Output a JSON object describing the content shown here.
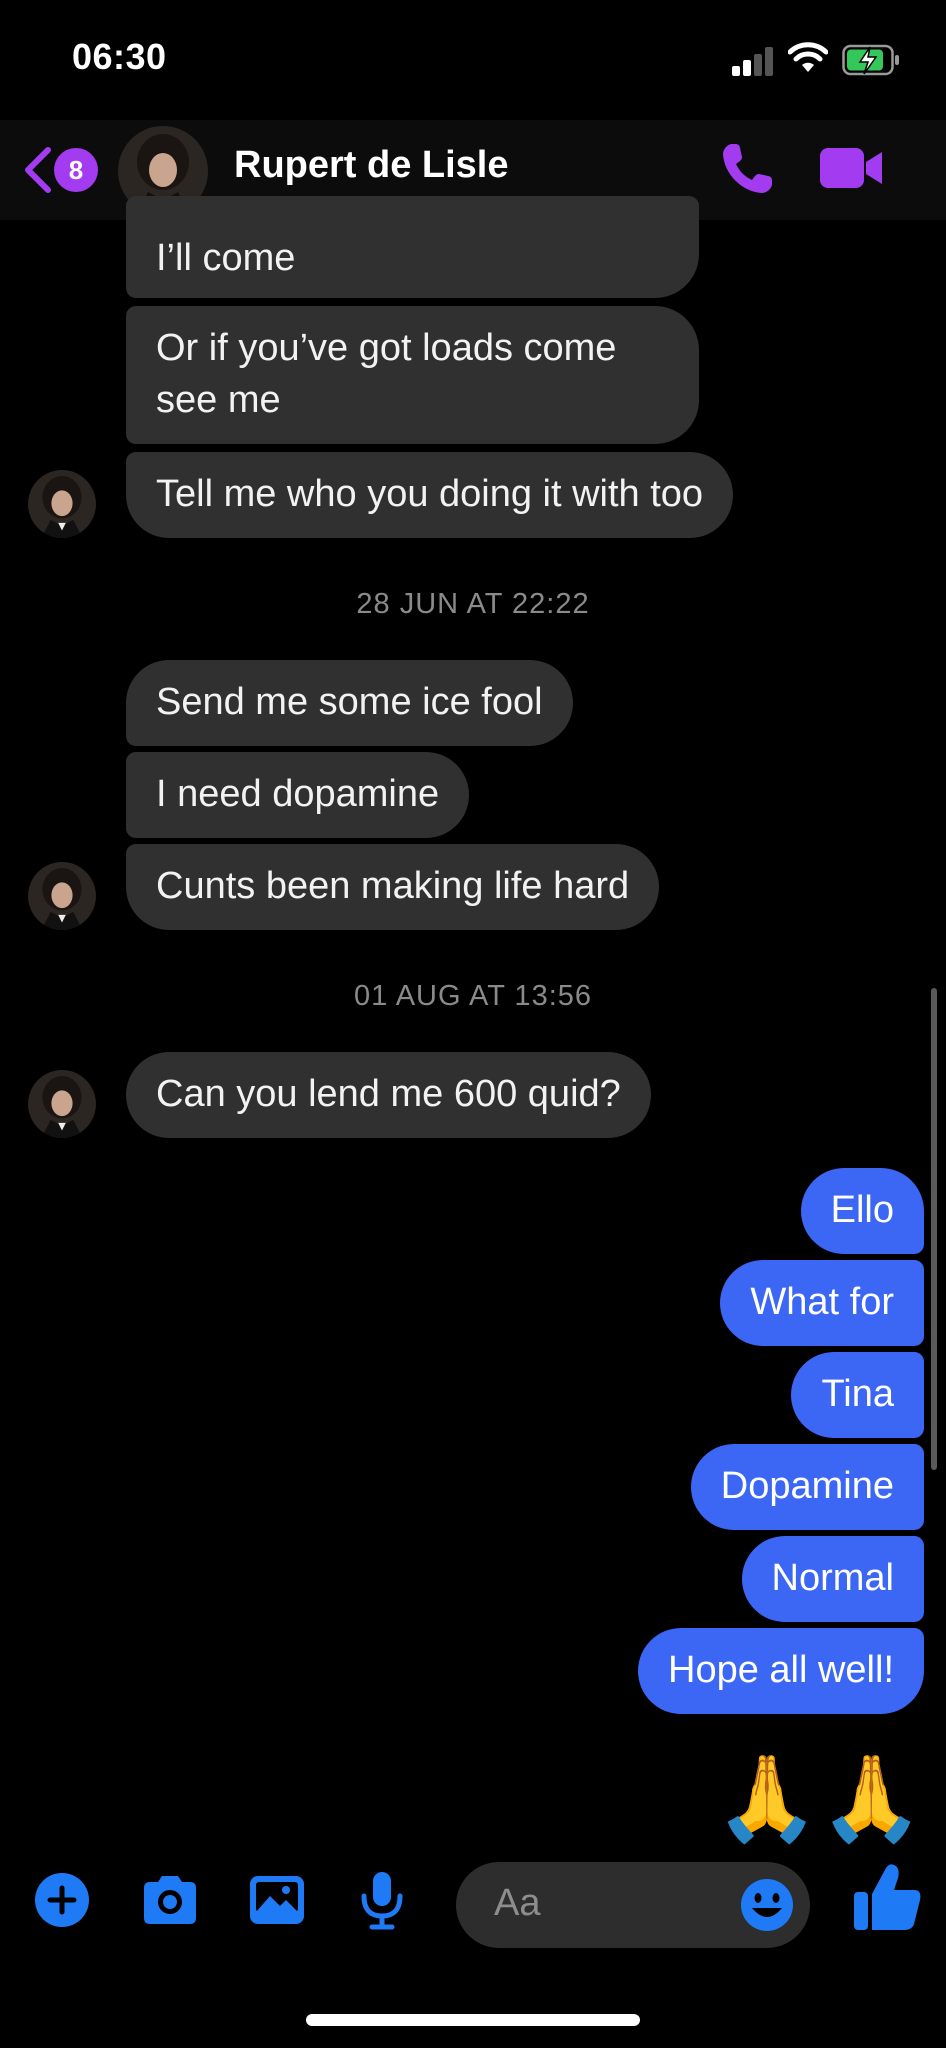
{
  "status_bar": {
    "time": "06:30"
  },
  "header": {
    "badge_count": "8",
    "contact_name": "Rupert de Lisle"
  },
  "conversation": {
    "group1": [
      "I’ll come",
      "Or if you’ve got loads come see me",
      "Tell me who you doing it with too"
    ],
    "timestamp1": "28 JUN AT 22:22",
    "group2": [
      "Send me some ice fool",
      "I need dopamine",
      "Cunts been making life hard"
    ],
    "timestamp2": "01 AUG AT 13:56",
    "group3": [
      "Can you lend me 600 quid?"
    ],
    "outgoing": [
      "Ello",
      "What for",
      "Tina",
      "Dopamine",
      "Normal",
      "Hope all well!"
    ],
    "emoji": "🙏🙏"
  },
  "composer": {
    "placeholder": "Aa"
  },
  "colors": {
    "accent_purple": "#a33bf0",
    "outgoing_bubble": "#3b67f4",
    "incoming_bubble": "#303030",
    "composer_blue": "#1f7af5"
  }
}
